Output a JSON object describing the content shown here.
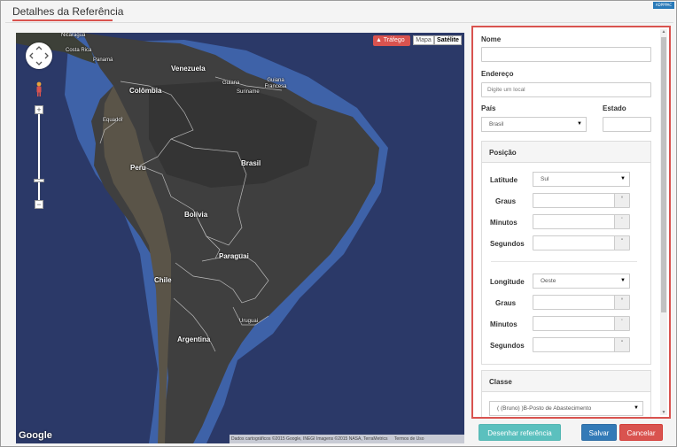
{
  "header": {
    "title": "Detalhes da Referência",
    "badge": "ADPPPAC"
  },
  "map": {
    "traffic_label": "Tráfego",
    "map_type_options": [
      "Mapa",
      "Satélite"
    ],
    "active_map_type": "Satélite",
    "labels": [
      "Nicaragua",
      "Costa Rica",
      "Panamá",
      "Venezuela",
      "Guiana",
      "Guiana Francesa",
      "Suriname",
      "Colômbia",
      "Equador",
      "Peru",
      "Brasil",
      "Bolívia",
      "Paraguai",
      "Chile",
      "Uruguai",
      "Argentina"
    ],
    "zoom_in": "+",
    "zoom_out": "−",
    "logo": "Google",
    "attribution": "Dados cartográficos ©2015 Google, INEGI Imagens ©2015 NASA, TerraMetrics",
    "terms": "Termos de Uso"
  },
  "form": {
    "nome": {
      "label": "Nome",
      "value": ""
    },
    "endereco": {
      "label": "Endereço",
      "placeholder": "Digite um local"
    },
    "pais": {
      "label": "País",
      "value": "Brasil"
    },
    "estado": {
      "label": "Estado",
      "value": ""
    },
    "posicao": {
      "title": "Posição",
      "latitude": {
        "label": "Latitude",
        "value": "Sul",
        "graus_label": "Graus",
        "minutos_label": "Minutos",
        "segundos_label": "Segundos"
      },
      "longitude": {
        "label": "Longitude",
        "value": "Oeste",
        "graus_label": "Graus",
        "minutos_label": "Minutos",
        "segundos_label": "Segundos"
      },
      "unit_deg": "°",
      "unit_min": "'",
      "unit_sec": "\""
    },
    "classe": {
      "title": "Classe",
      "value": "( (Bruno) )B-Posto de Abastecimento"
    }
  },
  "buttons": {
    "desenhar": "Desenhar referência",
    "salvar": "Salvar",
    "cancelar": "Cancelar"
  },
  "colors": {
    "accent_red": "#d9534f",
    "primary_blue": "#337ab7",
    "teal": "#5bc0be",
    "ocean": "#2c3a69"
  }
}
